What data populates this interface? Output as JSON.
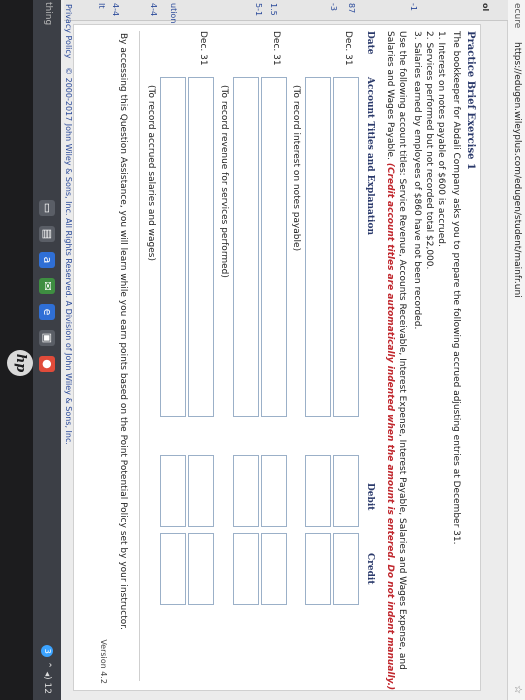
{
  "browser": {
    "security": "ecure",
    "url": "https://edugen.wileyplus.com/edugen/student/mainfr.uni"
  },
  "sidebar": [
    "ol",
    "-1",
    "87",
    "-3",
    "1.5",
    "5-1",
    "ution",
    "4-4",
    "4-4",
    "It"
  ],
  "exercise": {
    "title": "Practice Brief Exercise 1",
    "intro": "The bookkeeper for Abdali Company asks you to prepare the following accrued adjusting entries at December 31.",
    "items": [
      "1. Interest on notes payable of $600 is accrued.",
      "2. Services performed but not recorded total $2,000.",
      "3. Salaries earned by employees of $860 have not been recorded."
    ],
    "instruction_1": "Use the following account titles: Service Revenue, Accounts Receivable, Interest Expense, Interest Payable, Salaries and Wages Expense, and",
    "instruction_2": "Salaries and Wages Payable.",
    "instruction_red": "(Credit account titles are automatically indented when the amount is entered. Do not indent manually.)"
  },
  "table": {
    "headers": [
      "Date",
      "Account Titles and Explanation",
      "Debit",
      "Credit"
    ],
    "entries": [
      {
        "date": "Dec. 31",
        "note": "(To record interest on notes payable)"
      },
      {
        "date": "Dec. 31",
        "note": "(To record revenue for services performed)"
      },
      {
        "date": "Dec. 31",
        "note": "(To record accrued salaries and wages)"
      }
    ]
  },
  "footer": {
    "policy_text": "By accessing this Question Assistance, you will learn while you earn points based on the Point Potential Policy set by your instructor.",
    "version": "Version 4.2"
  },
  "copyright": {
    "privacy": "Privacy Policy",
    "notice": "© 2000-2017 John Wiley & Sons, Inc. All Rights Reserved. A Division of John Wiley & Sons, Inc."
  },
  "taskbar": {
    "search": "thing",
    "notification_count": "3",
    "clock": "12"
  },
  "brand": {
    "logo": "hp"
  }
}
